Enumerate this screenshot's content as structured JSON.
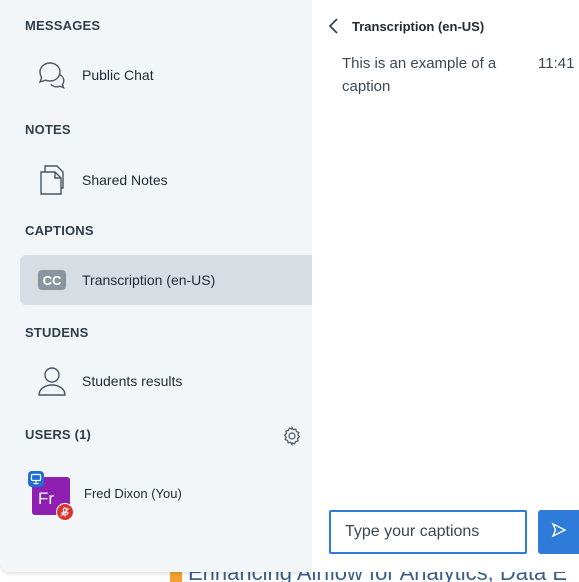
{
  "sidebar": {
    "messages": {
      "title": "MESSAGES",
      "items": [
        {
          "label": "Public Chat",
          "icon": "chat-bubbles-icon"
        }
      ]
    },
    "notes": {
      "title": "NOTES",
      "items": [
        {
          "label": "Shared Notes",
          "icon": "document-icon"
        }
      ]
    },
    "captions": {
      "title": "CAPTIONS",
      "items": [
        {
          "label": "Transcription (en-US)",
          "icon": "closed-captions-icon",
          "active": true
        }
      ]
    },
    "students": {
      "title": "STUDENS",
      "items": [
        {
          "label": "Students results",
          "icon": "user-outline-icon"
        }
      ]
    },
    "users": {
      "title": "USERS (1)",
      "settings_icon": "gear-icon",
      "list": [
        {
          "name": "Fred Dixon (You)",
          "initials": "Fr",
          "avatar_color": "#8e1fb0",
          "presenter": true,
          "muted": true
        }
      ]
    }
  },
  "panel": {
    "header_title": "Transcription (en-US)",
    "captions": [
      {
        "text": "This is an example of a caption",
        "time": "11:41"
      }
    ],
    "input_placeholder": "Type your captions",
    "send_icon": "send-arrow-icon"
  },
  "background": {
    "headline": "Enhancing Airflow for Analytics, Data E"
  },
  "colors": {
    "sidebar_bg": "#f3f6f9",
    "active_item_bg": "#d8dde3",
    "accent": "#2f7bd9",
    "avatar": "#8e1fb0",
    "muted_badge": "#e0332b"
  }
}
